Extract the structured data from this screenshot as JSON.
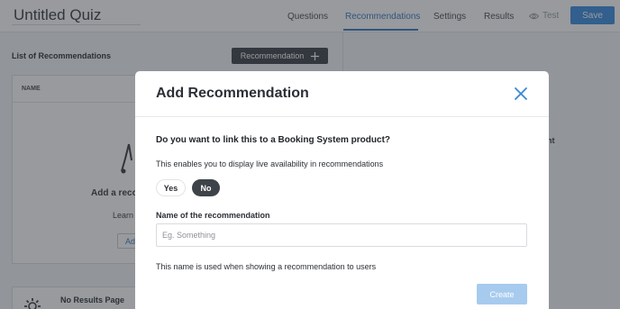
{
  "header": {
    "quiz_title": "Untitled Quiz",
    "tabs": [
      {
        "label": "Questions",
        "active": false
      },
      {
        "label": "Recommendations",
        "active": true
      },
      {
        "label": "Settings",
        "active": false
      },
      {
        "label": "Results",
        "active": false
      }
    ],
    "test_label": "Test",
    "test_icon": "eye-icon",
    "save_label": "Save"
  },
  "page": {
    "list_heading": "List of Recommendations",
    "add_button_label": "Recommendation",
    "add_button_icon": "plus-icon",
    "table": {
      "columns": [
        "NAME"
      ]
    },
    "empty_state": {
      "title": "Add a reco",
      "description": "Learn",
      "link_label": "Ad"
    },
    "right_panel_text": "nt",
    "no_results_label": "No Results Page",
    "no_results_icon": "gear-icon"
  },
  "modal": {
    "title": "Add Recommendation",
    "close_icon": "close-icon",
    "question": "Do you want to link this to a Booking System product?",
    "description": "This enables you to display live availability in recommendations",
    "options": [
      {
        "label": "Yes",
        "selected": false
      },
      {
        "label": "No",
        "selected": true
      }
    ],
    "name_label": "Name of the recommendation",
    "name_value": "",
    "name_placeholder": "Eg. Something",
    "name_help": "This name is used when showing a recommendation to users",
    "create_label": "Create"
  },
  "colors": {
    "accent": "#3a7cc7",
    "save_button": "#3d8fe0",
    "dark_button": "#3e4249",
    "create_disabled": "#a7cbee"
  }
}
